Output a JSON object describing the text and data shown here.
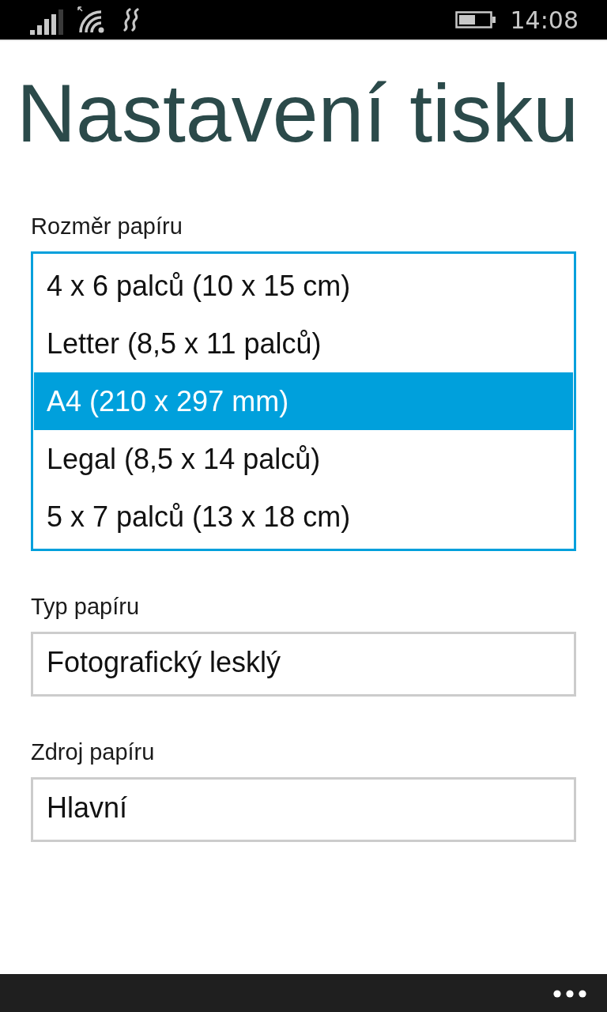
{
  "status_bar": {
    "time": "14:08"
  },
  "title": "Nastavení tisku",
  "fields": [
    {
      "kind": "list",
      "label": "Rozměr papíru",
      "options": [
        {
          "label": "4 x 6 palců (10 x 15 cm)",
          "selected": false
        },
        {
          "label": "Letter (8,5 x 11 palců)",
          "selected": false
        },
        {
          "label": "A4 (210 x 297 mm)",
          "selected": true
        },
        {
          "label": "Legal (8,5 x 14 palců)",
          "selected": false
        },
        {
          "label": "5 x 7 palců (13 x 18 cm)",
          "selected": false
        }
      ]
    },
    {
      "kind": "picker",
      "label": "Typ papíru",
      "value": "Fotografický lesklý"
    },
    {
      "kind": "picker",
      "label": "Zdroj papíru",
      "value": "Hlavní"
    }
  ]
}
